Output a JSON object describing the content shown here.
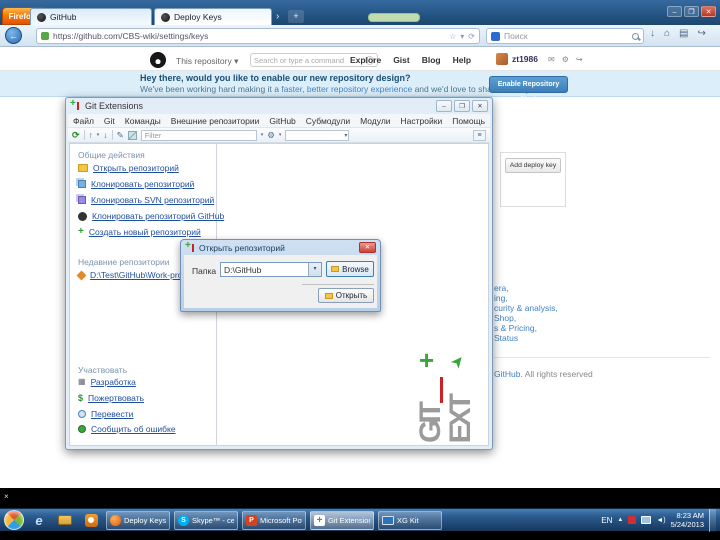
{
  "glyphs": {
    "caret": "▾",
    "close": "✕",
    "min": "–",
    "max": "❐",
    "back": "←",
    "star": "☆",
    "reload": "⟳",
    "plus": "+",
    "overflow": "›",
    "down": "↓",
    "home": "⌂",
    "list": "▤",
    "share": "↪",
    "mail": "✉",
    "gear": "⚙",
    "x_small": "×",
    "refresh": "⟳",
    "up": "↑",
    "pencil": "✎",
    "grid": "▦",
    "dollar": "$",
    "slash": "/",
    "speaker": "◄)",
    "para": "≡",
    "play": "▶",
    "arrow_up_right": "➤"
  },
  "browser": {
    "firefox_button": "Firefox",
    "tabs": [
      {
        "label": "GitHub"
      },
      {
        "label": "Deploy Keys"
      }
    ],
    "url": "https://github.com/CBS-wiki/settings/keys",
    "search_placeholder": "Поиск"
  },
  "github": {
    "header": {
      "scope": "This repository",
      "search_placeholder": "Search or type a command",
      "nav": [
        "Explore",
        "Gist",
        "Blog",
        "Help"
      ],
      "username": "zt1986"
    },
    "banner": {
      "line1": "Hey there, would you like to enable our new repository design?",
      "line2_pre": "We've been working hard making it a ",
      "line2_link": "faster, better repository experience",
      "line2_post": " and we'd love to share it with you.",
      "button": "Enable Repository Next"
    },
    "add_deploy_key": "Add deploy key",
    "footer_fragments": [
      "era,",
      "ing,",
      "curity & analysis,",
      "Shop,",
      "s & Pricing,",
      "Status"
    ],
    "footer_note_link": "GitHub.",
    "footer_note_rest": " All rights reserved"
  },
  "gitext": {
    "title": "Git Extensions",
    "menus": [
      "Файл",
      "Git",
      "Команды",
      "Внешние репозитории",
      "GitHub",
      "Субмодули",
      "Модули",
      "Настройки",
      "Помощь"
    ],
    "toolbar": {
      "filter_placeholder": "Filter"
    },
    "sections": {
      "common": {
        "header": "Общие действия",
        "items": [
          "Открыть репозиторий",
          "Клонировать репозиторий",
          "Клонировать SVN репозиторий",
          "Клонировать репозиторий GitHub",
          "Создать новый репозиторий"
        ]
      },
      "recent": {
        "header": "Недавние репозитории",
        "items": [
          "D:\\Test\\GitHub\\Work-program"
        ]
      },
      "contribute": {
        "header": "Участвовать",
        "items": [
          "Разработка",
          "Пожертвовать",
          "Перевести",
          "Сообщить об ошибке"
        ]
      }
    },
    "logo": {
      "git": "GIT",
      "ext": "EXT"
    }
  },
  "dialog": {
    "title": "Открыть репозиторий",
    "label": "Папка",
    "path_value": "D:\\GitHub",
    "browse_button": "Browse",
    "open_button": "Открыть"
  },
  "taskbar": {
    "tasks": [
      {
        "label": "Deploy Keys - Mo..."
      },
      {
        "label": "Skype™ - сеанс..."
      },
      {
        "label": "Microsoft PowerP..."
      },
      {
        "label": "Git Extensions"
      },
      {
        "label": "XG Kit"
      }
    ],
    "tray": {
      "lang": "EN",
      "time": "8:23 AM",
      "date": "5/24/2013"
    }
  },
  "colors": {
    "link_blue": "#4183c4",
    "banner_bg": "#dceef9",
    "button_blue": "#3d7fb5",
    "gitext_green": "#3aa53a",
    "gitext_red": "#cc2222",
    "gitext_gray": "#9b9b9b"
  }
}
